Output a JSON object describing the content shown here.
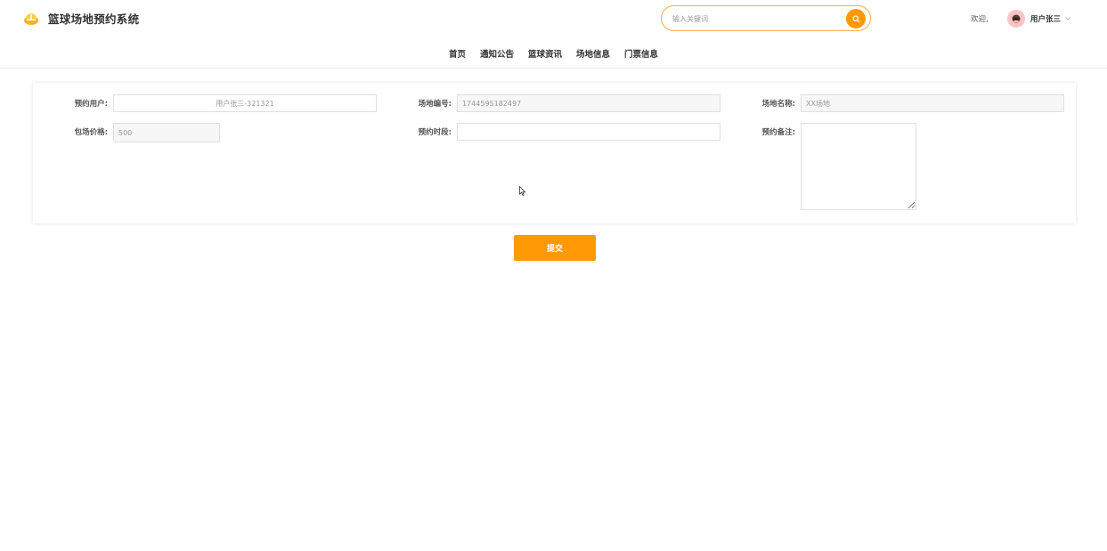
{
  "header": {
    "title": "篮球场地预约系统",
    "search_placeholder": "输入关键词",
    "welcome": "欢迎,",
    "username": "用户张三"
  },
  "nav": {
    "items": [
      "首页",
      "通知公告",
      "篮球资讯",
      "场地信息",
      "门票信息"
    ]
  },
  "form": {
    "user_label": "预约用户:",
    "user_value": "用户张三-321321",
    "venue_no_label": "场地编号:",
    "venue_no_value": "1744595182497",
    "venue_name_label": "场地名称:",
    "venue_name_value": "XX场地",
    "price_label": "包场价格:",
    "price_value": "500",
    "time_label": "预约时段:",
    "time_value": "",
    "remark_label": "预约备注:",
    "remark_value": ""
  },
  "submit_label": "提交",
  "colors": {
    "accent": "#ff9a06",
    "search_border": "#f5b14a"
  }
}
